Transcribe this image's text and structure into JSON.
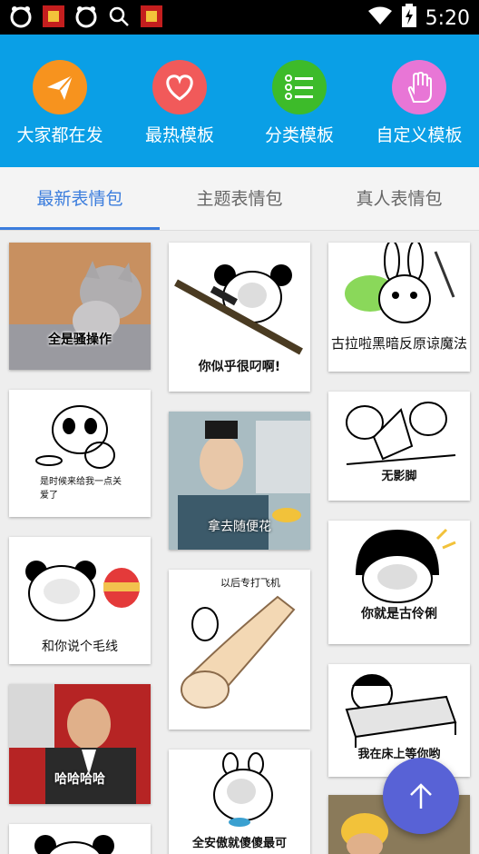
{
  "status_bar": {
    "time": "5:20"
  },
  "nav": [
    {
      "label": "大家都在发",
      "icon": "paper-plane-icon",
      "color": "#f7931e"
    },
    {
      "label": "最热模板",
      "icon": "heart-icon",
      "color": "#f15a5a"
    },
    {
      "label": "分类模板",
      "icon": "list-icon",
      "color": "#3dbb2a"
    },
    {
      "label": "自定义模板",
      "icon": "hand-icon",
      "color": "#e876d6"
    }
  ],
  "tabs": [
    {
      "label": "最新表情包",
      "active": true
    },
    {
      "label": "主题表情包",
      "active": false
    },
    {
      "label": "真人表情包",
      "active": false
    }
  ],
  "cards": {
    "c1": "全是骚操作",
    "c2": "你似乎很叼啊!",
    "c3": "古拉啦黑暗反原谅魔法",
    "c4": "是时候来给我一点关爱了",
    "c5": "拿去随便花",
    "c6": "无影脚",
    "c7": "和你说个毛线",
    "c8": "以后专打飞机",
    "c9": "你就是古伶俐",
    "c10": "哈哈哈哈",
    "c11": "我在床上等你哟",
    "c12": "全安傲就傻傻最可"
  },
  "colors": {
    "brand": "#0a9fe6",
    "accent": "#3b7ddd",
    "fab": "#5862d6"
  }
}
